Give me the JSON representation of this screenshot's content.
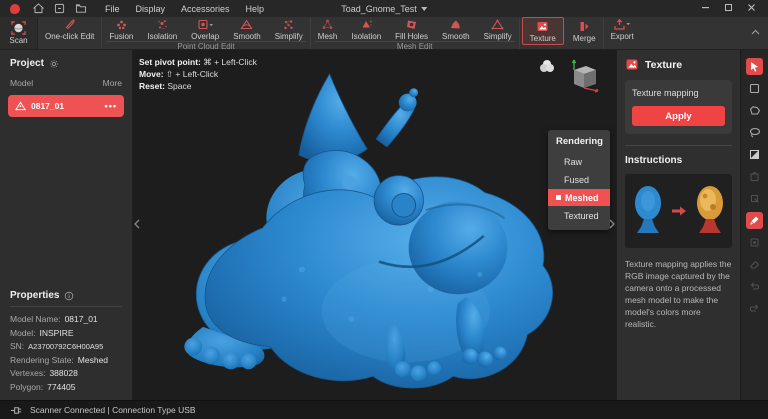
{
  "titlebar": {
    "title": "Toad_Gnome_Test",
    "menus": [
      "File",
      "Display",
      "Accessories",
      "Help"
    ]
  },
  "toolbar": {
    "scan_label": "Scan",
    "one_click_label": "One-click Edit",
    "pc_group_label": "Point Cloud Edit",
    "mesh_group_label": "Mesh Edit",
    "pc_buttons": [
      {
        "label": "Fusion"
      },
      {
        "label": "Isolation"
      },
      {
        "label": "Overlap"
      },
      {
        "label": "Smooth"
      },
      {
        "label": "Simplify"
      }
    ],
    "mesh_buttons": [
      {
        "label": "Mesh"
      },
      {
        "label": "Isolation"
      },
      {
        "label": "Fill Holes"
      },
      {
        "label": "Smooth"
      },
      {
        "label": "Simplify"
      }
    ],
    "texture_label": "Texture",
    "merge_label": "Merge",
    "export_label": "Export"
  },
  "project_panel": {
    "title": "Project",
    "model_label": "Model",
    "more_label": "More",
    "model_item": {
      "name": "0817_01",
      "more": "•••"
    }
  },
  "properties": {
    "title": "Properties",
    "rows": [
      {
        "label": "Model Name:",
        "value": "0817_01"
      },
      {
        "label": "Model:",
        "value": "INSPIRE"
      },
      {
        "label": "SN:",
        "value": "A23700792C6H00A95"
      },
      {
        "label": "Rendering State:",
        "value": "Meshed"
      },
      {
        "label": "Vertexes:",
        "value": "388028"
      },
      {
        "label": "Polygon:",
        "value": "774405"
      }
    ]
  },
  "viewport": {
    "hints": [
      {
        "label": "Set pivot point:",
        "value": "⌘ + Left-Click"
      },
      {
        "label": "Move:",
        "value": "⇧ + Left-Click"
      },
      {
        "label": "Reset:",
        "value": "Space"
      }
    ]
  },
  "rendering": {
    "title": "Rendering",
    "options": [
      {
        "label": "Raw"
      },
      {
        "label": "Fused"
      },
      {
        "label": "Meshed"
      },
      {
        "label": "Textured"
      }
    ],
    "selected": "Meshed"
  },
  "texture_panel": {
    "title": "Texture",
    "mapping_label": "Texture mapping",
    "apply_label": "Apply",
    "instructions_title": "Instructions",
    "description": "Texture mapping applies the RGB image captured by the camera onto a processed mesh model to make the model's colors more realistic."
  },
  "statusbar": {
    "text": "Scanner Connected | Connection Type USB"
  },
  "colors": {
    "accent": "#ef5252",
    "apply_red": "#f04343",
    "model_blue": "#2e8ad0"
  }
}
